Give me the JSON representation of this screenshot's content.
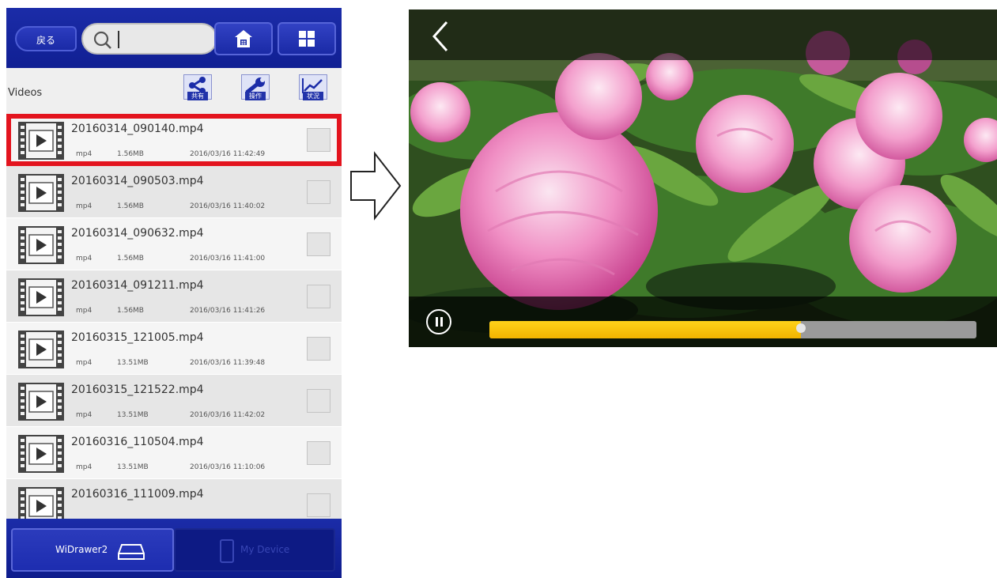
{
  "header": {
    "back_label": "戻る",
    "search_value": "",
    "search_placeholder": ""
  },
  "toolbar": {
    "folder_title": "Videos",
    "actions": [
      {
        "label": "共有",
        "icon": "share-icon"
      },
      {
        "label": "操作",
        "icon": "wrench-icon"
      },
      {
        "label": "状況",
        "icon": "chart-icon"
      }
    ]
  },
  "files": [
    {
      "name": "20160314_090140.mp4",
      "type": "mp4",
      "size": "1.56MB",
      "date": "2016/03/16 11:42:49",
      "selected": true
    },
    {
      "name": "20160314_090503.mp4",
      "type": "mp4",
      "size": "1.56MB",
      "date": "2016/03/16 11:40:02"
    },
    {
      "name": "20160314_090632.mp4",
      "type": "mp4",
      "size": "1.56MB",
      "date": "2016/03/16 11:41:00"
    },
    {
      "name": "20160314_091211.mp4",
      "type": "mp4",
      "size": "1.56MB",
      "date": "2016/03/16 11:41:26"
    },
    {
      "name": "20160315_121005.mp4",
      "type": "mp4",
      "size": "13.51MB",
      "date": "2016/03/16 11:39:48"
    },
    {
      "name": "20160315_121522.mp4",
      "type": "mp4",
      "size": "13.51MB",
      "date": "2016/03/16 11:42:02"
    },
    {
      "name": "20160316_110504.mp4",
      "type": "mp4",
      "size": "13.51MB",
      "date": "2016/03/16 11:10:06"
    },
    {
      "name": "20160316_111009.mp4",
      "type": "",
      "size": "",
      "date": ""
    }
  ],
  "bottom_tabs": {
    "widrawer_label": "WiDrawer2",
    "mydevice_label": "My Device"
  },
  "player": {
    "progress_fraction": 0.64
  },
  "colors": {
    "brand_blue": "#1b2ca8",
    "highlight_red": "#e3141e",
    "progress_yellow": "#f2b400"
  }
}
